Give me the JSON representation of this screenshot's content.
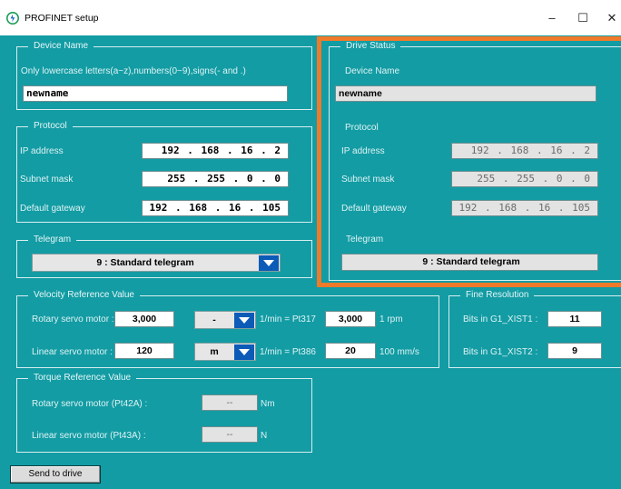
{
  "window": {
    "title": "PROFINET setup",
    "minimize_glyph": "–",
    "maximize_glyph": "☐",
    "close_glyph": "✕"
  },
  "device_name": {
    "legend": "Device Name",
    "hint": "Only lowercase letters(a~z),numbers(0~9),signs(- and .)",
    "value": "newname"
  },
  "protocol": {
    "legend": "Protocol",
    "ip_label": "IP address",
    "ip_value": "192 . 168 . 16 .  2",
    "subnet_label": "Subnet mask",
    "subnet_value": "255 . 255 .  0 .  0",
    "gateway_label": "Default gateway",
    "gateway_value": "192 . 168 . 16 . 105"
  },
  "telegram": {
    "legend": "Telegram",
    "selected": "9  : Standard telegram"
  },
  "drive_status": {
    "legend": "Drive Status",
    "device_name_label": "Device Name",
    "device_name_value": "newname",
    "protocol_label": "Protocol",
    "ip_label": "IP address",
    "ip_value": "192 . 168 . 16 .  2",
    "subnet_label": "Subnet mask",
    "subnet_value": "255 . 255 .  0 .  0",
    "gateway_label": "Default gateway",
    "gateway_value": "192 . 168 . 16 . 105",
    "telegram_label": "Telegram",
    "telegram_value": "9  : Standard telegram"
  },
  "velocity": {
    "legend": "Velocity Reference Value",
    "rotary_label": "Rotary servo motor :",
    "rotary_value": "3,000",
    "rotary_unit_select": "-",
    "rotary_unit_text": "1/min  =  Pt317",
    "rotary_param_value": "3,000",
    "rotary_param_unit": "1 rpm",
    "linear_label": "Linear servo motor :",
    "linear_value": "120",
    "linear_unit_select": "m",
    "linear_unit_text": "1/min  =  Pt386",
    "linear_param_value": "20",
    "linear_param_unit": "100 mm/s"
  },
  "fine_resolution": {
    "legend": "Fine Resolution",
    "xist1_label": "Bits in G1_XIST1 :",
    "xist1_value": "11",
    "xist2_label": "Bits in G1_XIST2 :",
    "xist2_value": "9"
  },
  "torque": {
    "legend": "Torque Reference Value",
    "rotary_label": "Rotary servo motor (Pt42A) :",
    "rotary_value": "--",
    "rotary_unit": "Nm",
    "linear_label": "Linear servo motor (Pt43A) :",
    "linear_value": "--",
    "linear_unit": "N"
  },
  "actions": {
    "send_label": "Send to drive"
  },
  "colors": {
    "background": "#139ca4",
    "highlight_border": "#ee7a2a",
    "dropdown_arrow": "#0b5bb7"
  },
  "icons": {
    "app": "power-refresh-icon",
    "dropdown": "chevron-down-icon"
  }
}
